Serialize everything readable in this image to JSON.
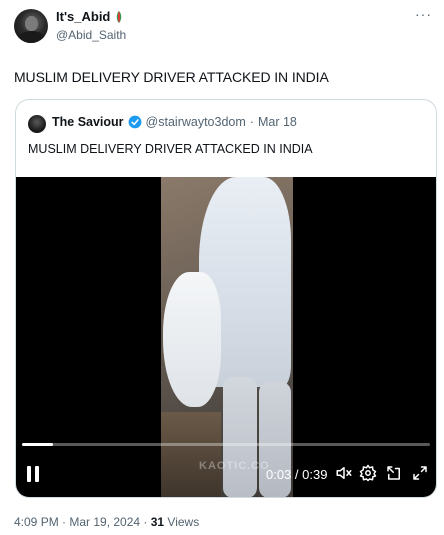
{
  "author": {
    "display_name": "It's_Abid",
    "flag_emoji": "🇵🇸",
    "handle": "@Abid_Saith",
    "more_label": "···"
  },
  "tweet": {
    "text": "MUSLIM DELIVERY DRIVER ATTACKED IN INDIA"
  },
  "quoted": {
    "display_name": "The Saviour",
    "handle": "@stairwayto3dom",
    "separator": "·",
    "date": "Mar 18",
    "text": "MUSLIM DELIVERY DRIVER ATTACKED IN INDIA",
    "verified_color": "#1d9bf0"
  },
  "video": {
    "watermark": "KAOTIC.CO",
    "time_display": "0:03 / 0:39",
    "progress_fraction": 0.077,
    "controls": [
      "pause-icon",
      "volume-muted-icon",
      "settings-gear-icon",
      "pop-out-icon",
      "fullscreen-icon"
    ]
  },
  "footer": {
    "timestamp": "4:09 PM · Mar 19, 2024 · ",
    "views_count": "31",
    "views_label": " Views"
  }
}
